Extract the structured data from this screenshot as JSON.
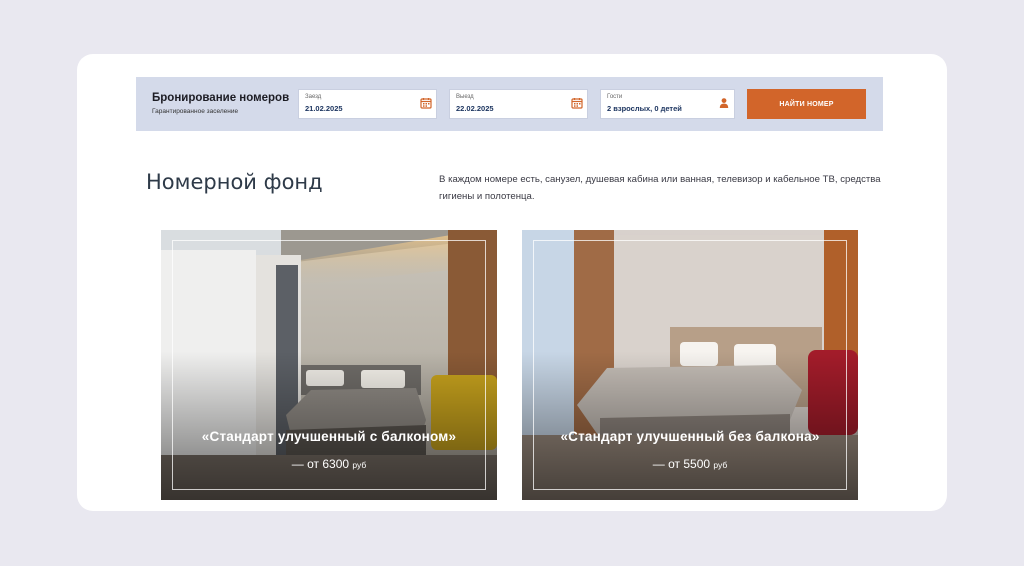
{
  "booking": {
    "title": "Бронирование номеров",
    "subtitle": "Гарантированное заселение",
    "checkin": {
      "label": "Заезд",
      "value": "21.02.2025",
      "icon": "calendar-icon"
    },
    "checkout": {
      "label": "Выезд",
      "value": "22.02.2025",
      "icon": "calendar-icon"
    },
    "guests": {
      "label": "Гости",
      "value": "2 взрослых, 0 детей",
      "icon": "person-icon"
    },
    "search_label": "НАЙТИ НОМЕР",
    "accent_color": "#d2652a"
  },
  "section": {
    "title": "Номерной фонд",
    "description": "В каждом номере есть, санузел, душевая кабина или ванная, телевизор и кабельное ТВ, средства гигиены и полотенца."
  },
  "rooms": [
    {
      "name": "«Стандарт улучшенный с балконом»",
      "price_prefix": "— от",
      "price": "6300",
      "currency": "руб"
    },
    {
      "name": "«Стандарт улучшенный без балкона»",
      "price_prefix": "— от",
      "price": "5500",
      "currency": "руб"
    }
  ]
}
